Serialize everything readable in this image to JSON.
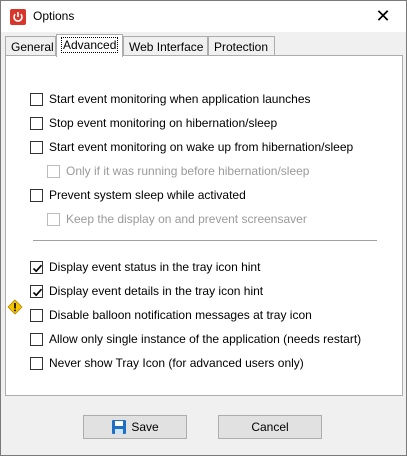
{
  "window": {
    "title": "Options",
    "icon": "power-icon",
    "close_glyph": "✕"
  },
  "tabs": [
    {
      "label": "General",
      "active": false
    },
    {
      "label": "Advanced",
      "active": true
    },
    {
      "label": "Web Interface",
      "active": false
    },
    {
      "label": "Protection",
      "active": false
    }
  ],
  "options": [
    {
      "label": "Start event monitoring when application launches",
      "checked": false,
      "enabled": true
    },
    {
      "label": "Stop event monitoring on hibernation/sleep",
      "checked": false,
      "enabled": true
    },
    {
      "label": "Start event monitoring on wake up from hibernation/sleep",
      "checked": false,
      "enabled": true
    },
    {
      "label": "Only if it was running before hibernation/sleep",
      "checked": false,
      "enabled": false
    },
    {
      "label": "Prevent system sleep while activated",
      "checked": false,
      "enabled": true
    },
    {
      "label": "Keep the display on and prevent screensaver",
      "checked": false,
      "enabled": false
    },
    {
      "label": "Display event status in the tray icon hint",
      "checked": true,
      "enabled": true
    },
    {
      "label": "Display event details in the tray icon hint",
      "checked": true,
      "enabled": true
    },
    {
      "label": "Disable balloon notification messages at tray icon",
      "checked": false,
      "enabled": true
    },
    {
      "label": "Allow only single instance of the application (needs restart)",
      "checked": false,
      "enabled": true
    },
    {
      "label": "Never show Tray Icon (for advanced users only)",
      "checked": false,
      "enabled": true,
      "warning_icon": "warning-icon"
    }
  ],
  "buttons": {
    "save": "Save",
    "cancel": "Cancel"
  },
  "colors": {
    "accent": "#d9362b",
    "warning": "#f5c400",
    "save_icon": "#1f6fc5"
  }
}
